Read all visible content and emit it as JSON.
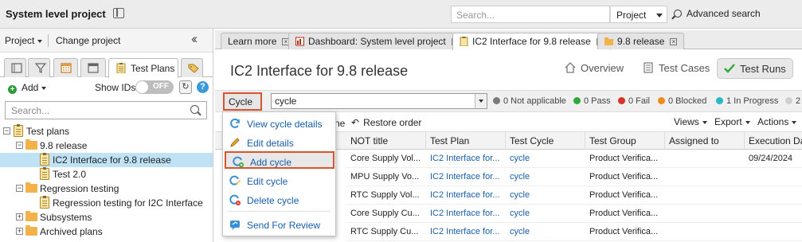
{
  "top": {
    "project_title": "System level project",
    "search_placeholder": "Search...",
    "scope": "Project",
    "advanced_search": "Advanced search"
  },
  "left": {
    "project_menu": "Project",
    "change_project": "Change project",
    "tabs": {
      "test_plans": "Test Plans"
    },
    "add": "Add",
    "show_ids": "Show IDs",
    "toggle": "OFF",
    "help": "?",
    "search_placeholder": "Search...",
    "tree": {
      "root": "Test plans",
      "release": "9.8 release",
      "ic2": "IC2 Interface for 9.8 release",
      "test20": "Test 2.0",
      "regression": "Regression testing",
      "regression_i2c": "Regression testing for I2C Interface",
      "subsystems": "Subsystems",
      "archived": "Archived plans"
    }
  },
  "tabs": [
    "Learn more",
    "Dashboard: System level project",
    "IC2 Interface for 9.8 release",
    "9.8 release"
  ],
  "main": {
    "title": "IC2 Interface for 9.8 release",
    "views": {
      "overview": "Overview",
      "test_cases": "Test Cases",
      "test_runs": "Test Runs"
    },
    "cycle_button": "Cycle",
    "cycle_value": "cycle",
    "status": [
      {
        "label": "0 Not applicable",
        "color": "#7a7a7a"
      },
      {
        "label": "0 Pass",
        "color": "#2ea836"
      },
      {
        "label": "0 Fail",
        "color": "#d8322c"
      },
      {
        "label": "0 Blocked",
        "color": "#f08a1c"
      },
      {
        "label": "1 In Progress",
        "color": "#2bb8c4"
      },
      {
        "label": "2",
        "color": "#cfcfcf"
      }
    ],
    "name_fragment": "ne",
    "restore_order": "Restore order",
    "views_menu": "Views",
    "export_menu": "Export",
    "actions_menu": "Actions",
    "columns": [
      "NOT title",
      "Test Plan",
      "Test Cycle",
      "Test Group",
      "Assigned to",
      "Execution Da"
    ],
    "rows": [
      [
        "Core Supply Vol...",
        "IC2 Interface for...",
        "cycle",
        "Product Verifica...",
        "",
        "09/24/2024"
      ],
      [
        "MPU Supply Vo...",
        "IC2 Interface for...",
        "cycle",
        "Product Verifica...",
        "",
        ""
      ],
      [
        "RTC Supply Vol...",
        "IC2 Interface for...",
        "cycle",
        "Product Verifica...",
        "",
        ""
      ],
      [
        "Core Supply Cu...",
        "IC2 Interface for...",
        "cycle",
        "Product Verifica...",
        "",
        ""
      ],
      [
        "RTC Supply Cu...",
        "IC2 Interface for...",
        "cycle",
        "Product Verifica...",
        "",
        ""
      ]
    ]
  },
  "menu": {
    "view_cycle_details": "View cycle details",
    "edit_details": "Edit details",
    "add_cycle": "Add cycle",
    "edit_cycle": "Edit cycle",
    "delete_cycle": "Delete cycle",
    "send_for_review": "Send For Review"
  }
}
